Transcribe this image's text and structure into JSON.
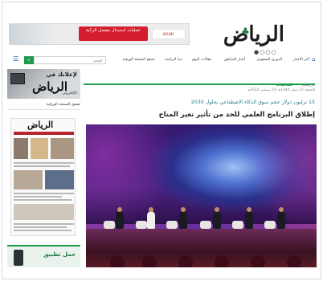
{
  "ad_banner": {
    "headline": "عمليات استبدال مفصل الركبة",
    "sponsor": "KSUMC"
  },
  "logo": {
    "text": "الرياض",
    "dots": "●○○○"
  },
  "nav": {
    "items": [
      {
        "label": "آخر الأخبار"
      },
      {
        "label": "الدوري السعودي"
      },
      {
        "label": "أخبار المناطق"
      },
      {
        "label": "مقالات اليوم"
      },
      {
        "label": "دنيا الرياضة"
      },
      {
        "label": "تصفح النسخة الورقية"
      }
    ],
    "search_placeholder": "البحث"
  },
  "sidebar": {
    "ad_text": "لإعلانك في",
    "ad_logo": "الرياض",
    "ad_sub": "الإلكتروني",
    "paper_heading": "تصفح النسخة الورقية",
    "paper_masthead": "الرياض",
    "app_promo": "حمل تطبيق"
  },
  "breadcrumb": {
    "home": "الرئيسية",
    "section": "المحليات"
  },
  "article": {
    "date": "الجمعة 25 صفر 1444هـ 16 سبتمبر 2022م",
    "kicker": "15 ترليون دولار حجم سوق الذكاء الاصطناعي بحلول 2030",
    "title": "إطلاق البرنامج العلمي للحد من تأثير تغير المناخ"
  },
  "icons": {
    "menu": "menu-icon",
    "search": "search-icon",
    "home": "home-icon"
  },
  "colors": {
    "accent": "#1f9b4c",
    "kicker": "#2b7b8a",
    "ad_red": "#d51e2d"
  }
}
